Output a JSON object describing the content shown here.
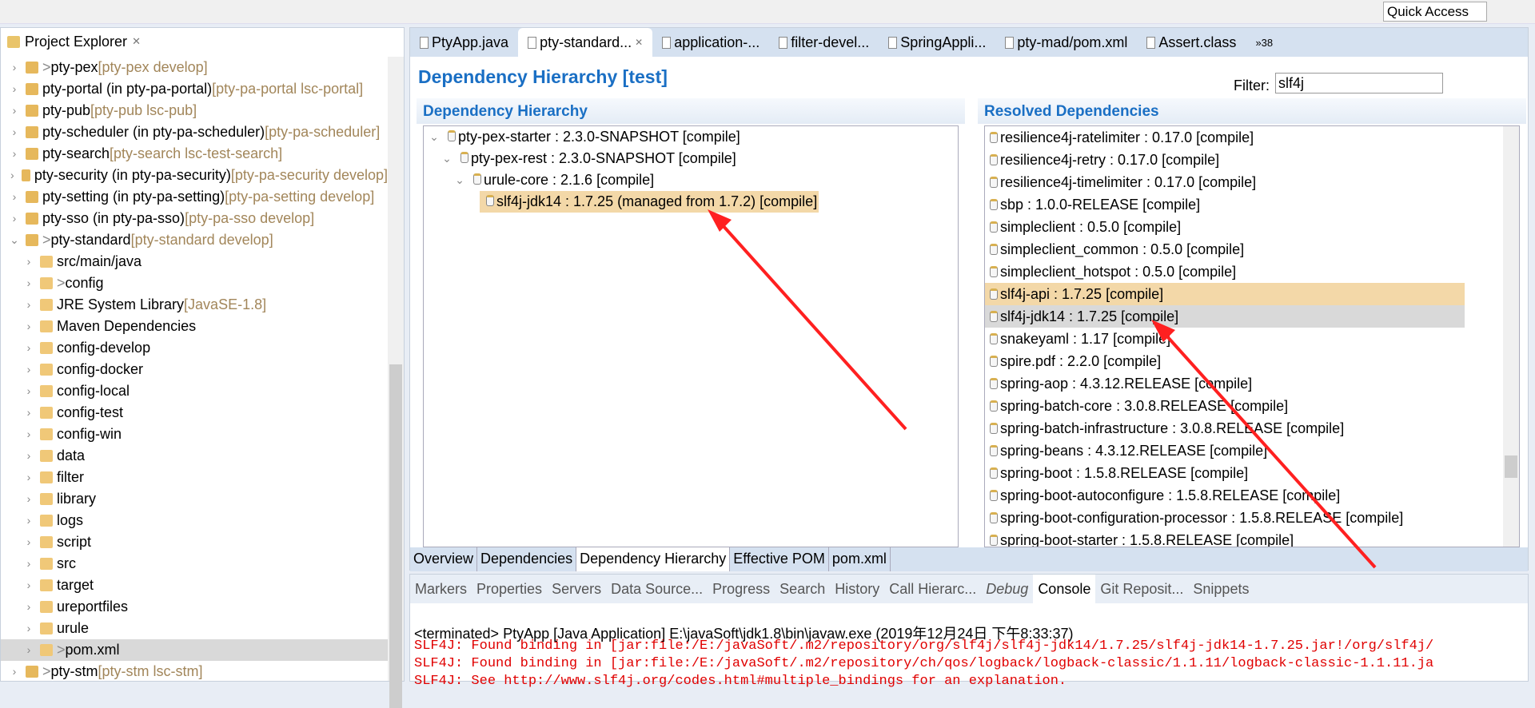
{
  "toolbar": {
    "quick_access": "Quick Access"
  },
  "explorer": {
    "title": "Project Explorer",
    "items": [
      {
        "prefix": "> ",
        "name": "pty-pex",
        "deco": " [pty-pex develop]",
        "level": 0,
        "open": false
      },
      {
        "prefix": "",
        "name": "pty-portal (in pty-pa-portal)",
        "deco": " [pty-pa-portal lsc-portal]",
        "level": 0,
        "open": false
      },
      {
        "prefix": "",
        "name": "pty-pub",
        "deco": " [pty-pub lsc-pub]",
        "level": 0,
        "open": false
      },
      {
        "prefix": "",
        "name": "pty-scheduler (in pty-pa-scheduler)",
        "deco": " [pty-pa-scheduler]",
        "level": 0,
        "open": false
      },
      {
        "prefix": "",
        "name": "pty-search",
        "deco": " [pty-search lsc-test-search]",
        "level": 0,
        "open": false
      },
      {
        "prefix": "",
        "name": "pty-security (in pty-pa-security)",
        "deco": " [pty-pa-security develop]",
        "level": 0,
        "open": false
      },
      {
        "prefix": "",
        "name": "pty-setting (in pty-pa-setting)",
        "deco": " [pty-pa-setting develop]",
        "level": 0,
        "open": false
      },
      {
        "prefix": "",
        "name": "pty-sso (in pty-pa-sso)",
        "deco": " [pty-pa-sso develop]",
        "level": 0,
        "open": false
      },
      {
        "prefix": "> ",
        "name": "pty-standard",
        "deco": " [pty-standard develop]",
        "level": 0,
        "open": true
      },
      {
        "prefix": "",
        "name": "src/main/java",
        "deco": "",
        "level": 1
      },
      {
        "prefix": "> ",
        "name": "config",
        "deco": "",
        "level": 1
      },
      {
        "prefix": "",
        "name": "JRE System Library",
        "deco": " [JavaSE-1.8]",
        "level": 1
      },
      {
        "prefix": "",
        "name": "Maven Dependencies",
        "deco": "",
        "level": 1
      },
      {
        "prefix": "",
        "name": "config-develop",
        "deco": "",
        "level": 1
      },
      {
        "prefix": "",
        "name": "config-docker",
        "deco": "",
        "level": 1
      },
      {
        "prefix": "",
        "name": "config-local",
        "deco": "",
        "level": 1
      },
      {
        "prefix": "",
        "name": "config-test",
        "deco": "",
        "level": 1
      },
      {
        "prefix": "",
        "name": "config-win",
        "deco": "",
        "level": 1
      },
      {
        "prefix": "",
        "name": "data",
        "deco": "",
        "level": 1
      },
      {
        "prefix": "",
        "name": "filter",
        "deco": "",
        "level": 1
      },
      {
        "prefix": "",
        "name": "library",
        "deco": "",
        "level": 1
      },
      {
        "prefix": "",
        "name": "logs",
        "deco": "",
        "level": 1
      },
      {
        "prefix": "",
        "name": "script",
        "deco": "",
        "level": 1
      },
      {
        "prefix": "",
        "name": "src",
        "deco": "",
        "level": 1
      },
      {
        "prefix": "",
        "name": "target",
        "deco": "",
        "level": 1
      },
      {
        "prefix": "",
        "name": "ureportfiles",
        "deco": "",
        "level": 1
      },
      {
        "prefix": "",
        "name": "urule",
        "deco": "",
        "level": 1
      },
      {
        "prefix": "> ",
        "name": "pom.xml",
        "deco": "",
        "level": 1,
        "selected": true
      },
      {
        "prefix": "> ",
        "name": "pty-stm",
        "deco": " [pty-stm lsc-stm]",
        "level": 0,
        "open": false
      }
    ]
  },
  "editor": {
    "tabs": [
      "PtyApp.java",
      "pty-standard...",
      "application-...",
      "filter-devel...",
      "SpringAppli...",
      "pty-mad/pom.xml",
      "Assert.class"
    ],
    "active_tab": 1,
    "overflow": "»38",
    "title": "Dependency Hierarchy [test]",
    "filter_label": "Filter:",
    "filter_value": "slf4j",
    "hierarchy": {
      "title": "Dependency Hierarchy",
      "rows": [
        {
          "text": "pty-pex-starter : 2.3.0-SNAPSHOT [compile]",
          "level": 0
        },
        {
          "text": "pty-pex-rest : 2.3.0-SNAPSHOT [compile]",
          "level": 1
        },
        {
          "text": "urule-core : 2.1.6 [compile]",
          "level": 2
        },
        {
          "text": "slf4j-jdk14 : 1.7.25 (managed from 1.7.2) [compile]",
          "level": 3,
          "highlight": true
        }
      ]
    },
    "resolved": {
      "title": "Resolved Dependencies",
      "rows": [
        "resilience4j-ratelimiter : 0.17.0 [compile]",
        "resilience4j-retry : 0.17.0 [compile]",
        "resilience4j-timelimiter : 0.17.0 [compile]",
        "sbp : 1.0.0-RELEASE [compile]",
        "simpleclient : 0.5.0 [compile]",
        "simpleclient_common : 0.5.0 [compile]",
        "simpleclient_hotspot : 0.5.0 [compile]",
        "slf4j-api : 1.7.25 [compile]",
        "slf4j-jdk14 : 1.7.25 [compile]",
        "snakeyaml : 1.17 [compile]",
        "spire.pdf : 2.2.0 [compile]",
        "spring-aop : 4.3.12.RELEASE [compile]",
        "spring-batch-core : 3.0.8.RELEASE [compile]",
        "spring-batch-infrastructure : 3.0.8.RELEASE [compile]",
        "spring-beans : 4.3.12.RELEASE [compile]",
        "spring-boot : 1.5.8.RELEASE [compile]",
        "spring-boot-autoconfigure : 1.5.8.RELEASE [compile]",
        "spring-boot-configuration-processor : 1.5.8.RELEASE [compile]",
        "spring-boot-starter : 1.5.8.RELEASE [compile]"
      ],
      "highlight_index": 7,
      "selected_index": 8
    },
    "bottom_tabs": [
      "Overview",
      "Dependencies",
      "Dependency Hierarchy",
      "Effective POM",
      "pom.xml"
    ],
    "active_bottom_tab": 2
  },
  "console": {
    "tabs": [
      "Markers",
      "Properties",
      "Servers",
      "Data Source...",
      "Progress",
      "Search",
      "History",
      "Call Hierarc...",
      "Debug",
      "Console",
      "Git Reposit...",
      "Snippets"
    ],
    "active_tab": 9,
    "terminated": "<terminated> PtyApp [Java Application] E:\\javaSoft\\jdk1.8\\bin\\javaw.exe (2019年12月24日 下午8:33:37)",
    "lines": [
      "SLF4J: Found binding in [jar:file:/E:/javaSoft/.m2/repository/org/slf4j/slf4j-jdk14/1.7.25/slf4j-jdk14-1.7.25.jar!/org/slf4j/",
      "SLF4J: Found binding in [jar:file:/E:/javaSoft/.m2/repository/ch/qos/logback/logback-classic/1.1.11/logback-classic-1.1.11.ja",
      "SLF4J: See http://www.slf4j.org/codes.html#multiple_bindings for an explanation."
    ],
    "error_color": "#e00000"
  },
  "colors": {
    "accent": "#1a6fc4",
    "highlight": "#f3d8a8",
    "annotation": "#ff2020"
  }
}
